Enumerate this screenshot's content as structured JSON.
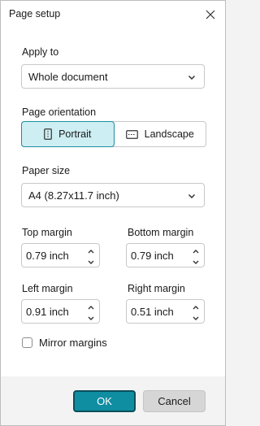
{
  "window": {
    "title": "Page setup"
  },
  "apply_to": {
    "label": "Apply to",
    "selected": "Whole document"
  },
  "orientation": {
    "label": "Page orientation",
    "options": [
      {
        "label": "Portrait",
        "selected": true
      },
      {
        "label": "Landscape",
        "selected": false
      }
    ]
  },
  "paper_size": {
    "label": "Paper size",
    "selected": "A4 (8.27x11.7 inch)"
  },
  "margins": {
    "top": {
      "label": "Top margin",
      "value": "0.79 inch"
    },
    "bottom": {
      "label": "Bottom margin",
      "value": "0.79 inch"
    },
    "left": {
      "label": "Left margin",
      "value": "0.91 inch"
    },
    "right": {
      "label": "Right margin",
      "value": "0.51 inch"
    }
  },
  "mirror": {
    "label": "Mirror margins",
    "checked": false
  },
  "buttons": {
    "ok": "OK",
    "cancel": "Cancel"
  },
  "colors": {
    "accent": "#0f8da1",
    "selected_bg": "#cdeef2"
  }
}
